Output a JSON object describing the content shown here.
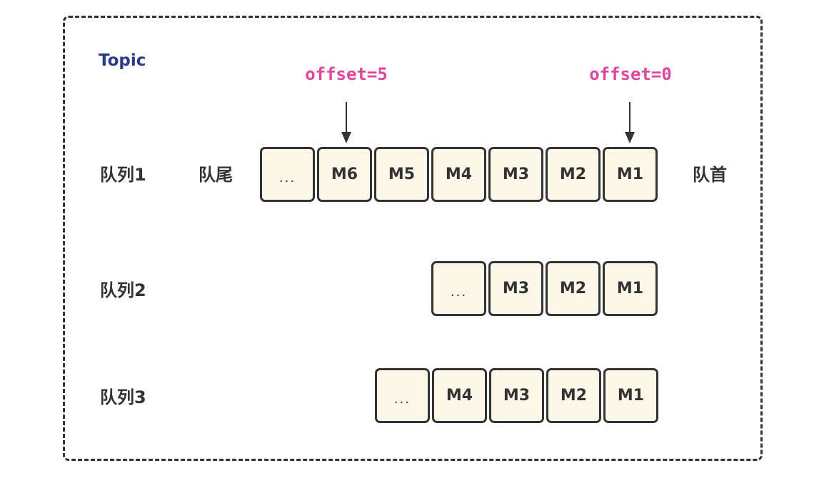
{
  "topic": {
    "label": "Topic"
  },
  "offsets": {
    "left": "offset=5",
    "right": "offset=0"
  },
  "queue1": {
    "label": "队列1",
    "tail_label": "队尾",
    "head_label": "队首",
    "cells": [
      "...",
      "M6",
      "M5",
      "M4",
      "M3",
      "M2",
      "M1"
    ]
  },
  "queue2": {
    "label": "队列2",
    "cells": [
      "...",
      "M3",
      "M2",
      "M1"
    ]
  },
  "queue3": {
    "label": "队列3",
    "cells": [
      "...",
      "M4",
      "M3",
      "M2",
      "M1"
    ]
  },
  "colors": {
    "topic_text": "#2d3a8c",
    "offset_text": "#e0469b",
    "cell_fill": "#fbf8ea",
    "stroke": "#333333"
  }
}
